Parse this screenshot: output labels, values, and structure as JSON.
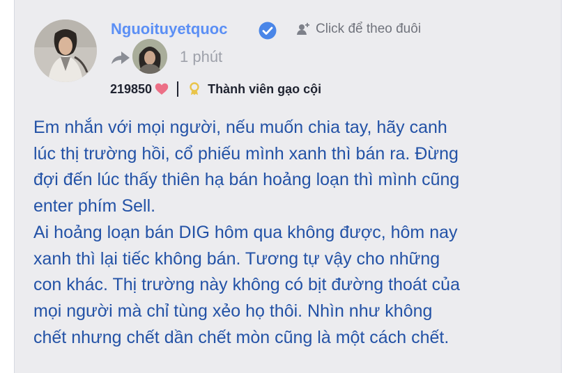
{
  "post": {
    "author": "Nguoituyetquoc",
    "follow_label": "Click để theo đuôi",
    "time_ago": "1 phút",
    "points": "219850",
    "rank": "Thành viên gạo cội",
    "body": "Em nhắn với mọi người, nếu muốn chia tay, hãy canh\nlúc thị trường hồi, cổ phiếu mình xanh thì bán ra. Đừng\nđợi đến lúc thấy thiên hạ bán hoảng loạn thì mình cũng\nenter phím Sell.\nAi hoảng loạn bán DIG hôm qua không được, hôm nay\nxanh thì lại tiếc không bán. Tương tự vậy cho những\ncon khác. Thị trường này không có bịt đường thoát của\nmọi người mà chỉ tùng xẻo họ thôi. Nhìn như không\nchết nhưng chết dần chết mòn cũng là một cách chết."
  },
  "icons": {
    "verified": "verified-check-icon",
    "follow": "add-user-icon",
    "share": "share-arrow-icon",
    "heart": "heart-icon",
    "badge": "award-badge-icon"
  },
  "colors": {
    "author_name": "#5b8ff5",
    "verified_badge": "#4a86e8",
    "body_text": "#2352a6",
    "heart": "#ec6f86",
    "badge": "#e9c44a",
    "card_background": "#ececef"
  }
}
